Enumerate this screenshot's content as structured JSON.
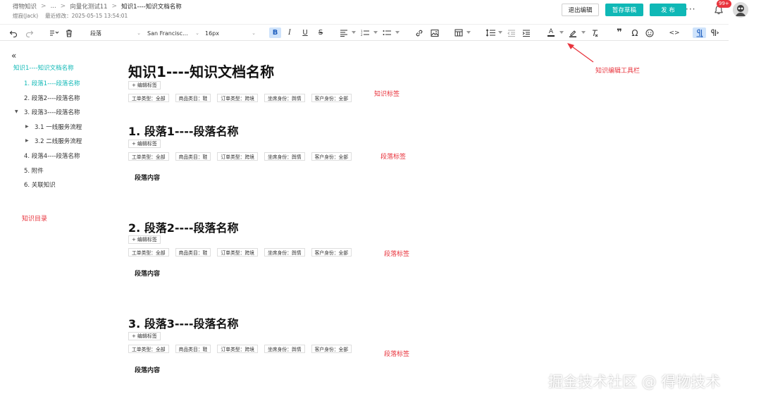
{
  "header": {
    "breadcrumb": [
      {
        "label": "得物知识"
      },
      {
        "label": "..."
      },
      {
        "label": "向量化测试11"
      },
      {
        "label": "知识1----知识文档名称"
      }
    ],
    "author": "煜寂(Jack)",
    "last_modified_label": "最近修改：",
    "last_modified": "2025-05-15 13:54:01",
    "exit_label": "退出编辑",
    "draft_label": "暂存草稿",
    "publish_label": "发 布",
    "more_label": "···",
    "notification_count": "99+"
  },
  "toolbar": {
    "block_type": "段落",
    "font_family": "San Francisc...",
    "font_size": "16px"
  },
  "sidebar": {
    "title": "知识1----知识文档名称",
    "items": [
      {
        "label": "1. 段落1----段落名称"
      },
      {
        "label": "2. 段落2----段落名称"
      },
      {
        "label": "3. 段落3----段落名称"
      },
      {
        "label": "3.1 一线服务流程"
      },
      {
        "label": "3.2 二线服务流程"
      },
      {
        "label": "4. 段落4----段落名称"
      },
      {
        "label": "5. 附件"
      },
      {
        "label": "6. 关联知识"
      }
    ]
  },
  "document": {
    "title": "知识1----知识文档名称",
    "edit_tag_label": "编辑标签",
    "tags": [
      "工单类型：全部",
      "商品类目：鞋",
      "订单类型：跨境",
      "坐席身份：舆情",
      "客户身份：全部"
    ],
    "sections": [
      {
        "heading": "1. 段落1----段落名称",
        "content": "段落内容"
      },
      {
        "heading": "2. 段落2----段落名称",
        "content": "段落内容"
      },
      {
        "heading": "3. 段落3----段落名称",
        "content": "段落内容"
      }
    ]
  },
  "annotations": {
    "toolbar": "知识编辑工具栏",
    "knowledge_tags": "知识标签",
    "paragraph_tags": "段落标签",
    "toc": "知识目录"
  },
  "watermark": "掘金技术社区 @ 得物技术",
  "colors": {
    "accent": "#0fb8b6",
    "annotation": "#e8343d",
    "active_tool": "#cfe3fb"
  }
}
